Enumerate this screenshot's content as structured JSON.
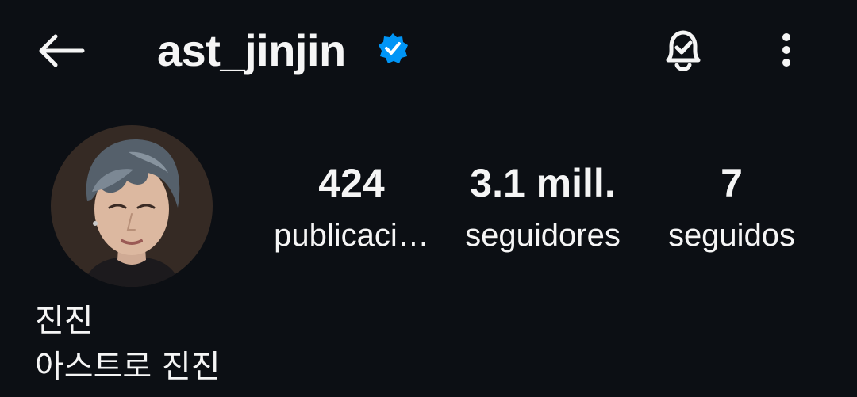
{
  "header": {
    "username": "ast_jinjin",
    "verified": true,
    "back_icon": "arrow-left-icon",
    "bell_icon": "bell-check-icon",
    "more_icon": "more-vertical-icon"
  },
  "profile": {
    "avatar": "profile-photo",
    "display_name": "진진",
    "bio": "아스트로 진진"
  },
  "stats": {
    "posts": {
      "value": "424",
      "label": "publicaci…"
    },
    "followers": {
      "value": "3.1 mill.",
      "label": "seguidores"
    },
    "following": {
      "value": "7",
      "label": "seguidos"
    }
  },
  "colors": {
    "background": "#0c0f14",
    "text": "#f5f5f5",
    "verified_badge": "#0095f6"
  }
}
